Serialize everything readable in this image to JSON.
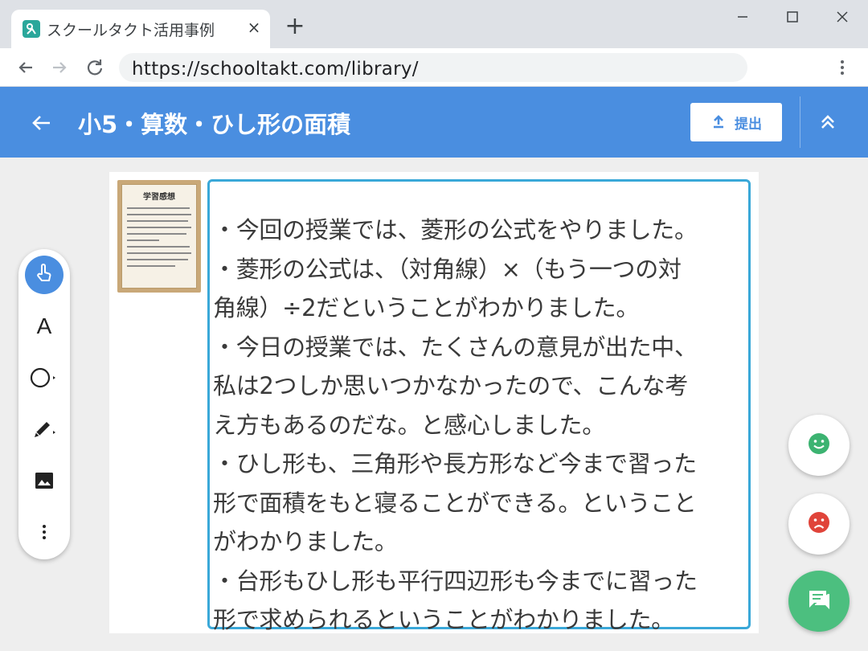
{
  "browser": {
    "tab_title": "スクールタクト活用事例",
    "tab_close": "×",
    "new_tab": "+",
    "url": "https://schooltakt.com/library/",
    "favicon_color": "#2aa79b"
  },
  "header": {
    "title": "小5・算数・ひし形の面積",
    "submit_label": "提出",
    "background_color": "#4a8ee0"
  },
  "worksheet": {
    "thumbnail_title": "学習感想",
    "answer_text": "・今回の授業では、菱形の公式をやりました。\n・菱形の公式は、（対角線）×（もう一つの対\n角線）÷2だということがわかりました。\n・今日の授業では、たくさんの意見が出た中、\n私は2つしか思いつかなかったので、こんな考\nえ方もあるのだな。と感心しました。\n・ひし形も、三角形や長方形など今まで習った\n形で面積をもと寝ることができる。ということ\nがわかりました。\n・台形もひし形も平行四辺形も今までに習った\n形で求められるということがわかりました。",
    "border_color": "#3aa8d8"
  },
  "tools": {
    "text_tool_label": "A",
    "icons": [
      "pointer-hand-icon",
      "text-icon",
      "circle-shape-icon",
      "pencil-icon",
      "image-icon",
      "more-vertical-icon"
    ]
  },
  "reactions": {
    "good_color": "#3cb371",
    "bad_color": "#e0443a",
    "comment_color": "#4cbf7f"
  }
}
